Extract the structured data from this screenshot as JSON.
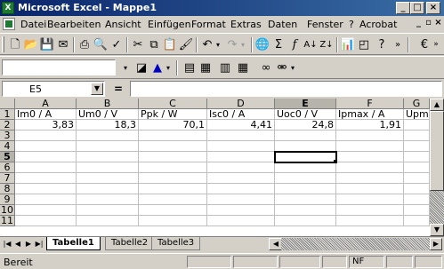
{
  "window": {
    "title": "Microsoft Excel - Mappe1"
  },
  "menu": {
    "items": [
      "Datei",
      "Bearbeiten",
      "Ansicht",
      "Einfügen",
      "Format",
      "Extras",
      "Daten",
      "Fenster",
      "?",
      "Acrobat"
    ]
  },
  "formula_bar": {
    "name_box": "E5",
    "equals": "=",
    "formula": ""
  },
  "grid": {
    "columns": [
      "A",
      "B",
      "C",
      "D",
      "E",
      "F",
      "G"
    ],
    "rows": [
      "1",
      "2",
      "3",
      "4",
      "5",
      "6",
      "7",
      "8",
      "9",
      "10",
      "11"
    ],
    "row1": [
      "Im0 / A",
      "Um0 / V",
      "Ppk / W",
      "Isc0 / A",
      "Uoc0 / V",
      "Ipmax / A",
      "Upmax /"
    ],
    "row2": [
      "3,83",
      "18,3",
      "70,1",
      "4,41",
      "24,8",
      "1,91",
      ""
    ],
    "selected_cell": "E5"
  },
  "sheets": {
    "tabs": [
      "Tabelle1",
      "Tabelle2",
      "Tabelle3"
    ],
    "active": "Tabelle1"
  },
  "status": {
    "text": "Bereit",
    "nf": "NF"
  },
  "icons": {
    "app": "excel-icon",
    "new": "new-doc-icon",
    "open": "open-folder-icon",
    "save": "save-icon",
    "print": "print-icon",
    "preview": "print-preview-icon",
    "spell": "spellcheck-icon",
    "cut": "cut-icon",
    "copy": "copy-icon",
    "paste": "paste-icon",
    "format_painter": "format-painter-icon",
    "undo": "undo-icon",
    "redo": "redo-icon",
    "hyperlink": "hyperlink-icon",
    "autosum": "autosum-icon",
    "function": "function-icon",
    "sort_asc": "sort-ascending-icon",
    "sort_desc": "sort-descending-icon",
    "chart": "chart-wizard-icon",
    "help": "help-icon",
    "euro": "euro-icon"
  }
}
